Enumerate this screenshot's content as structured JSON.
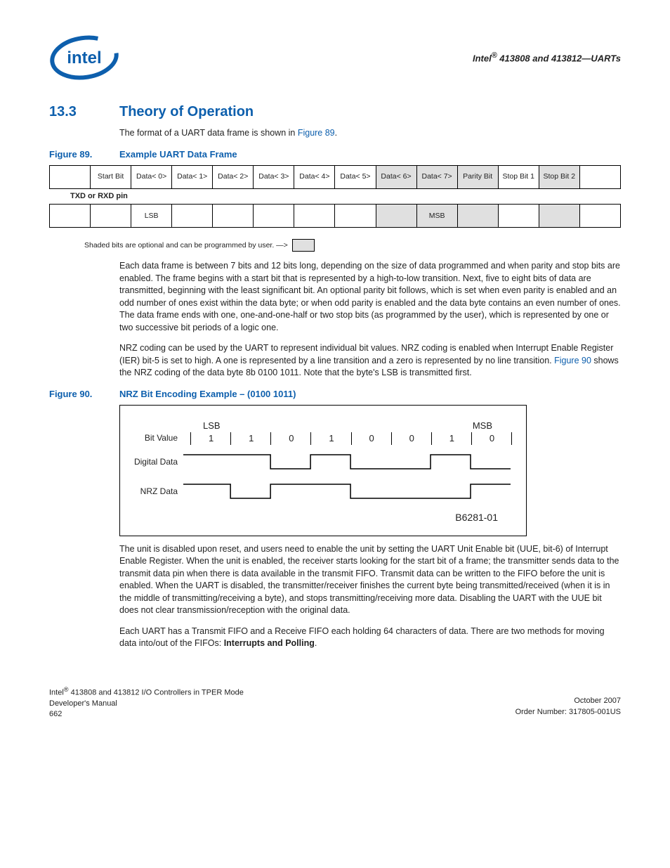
{
  "header": {
    "text_prefix": "Intel",
    "text_suffix": " 413808 and 413812—UARTs"
  },
  "section": {
    "num": "13.3",
    "title": "Theory of Operation"
  },
  "intro": {
    "pre": "The format of a UART data frame is shown in ",
    "link": "Figure 89",
    "post": "."
  },
  "fig89": {
    "num": "Figure 89.",
    "title": "Example UART Data Frame",
    "cols": [
      "",
      "Start Bit",
      "Data< 0>",
      "Data< 1>",
      "Data< 2>",
      "Data< 3>",
      "Data< 4>",
      "Data< 5>",
      "Data< 6>",
      "Data< 7>",
      "Parity Bit",
      "Stop Bit 1",
      "Stop Bit 2",
      ""
    ],
    "pin": "TXD or RXD pin",
    "row2": [
      "",
      "",
      "LSB",
      "",
      "",
      "",
      "",
      "",
      "",
      "MSB",
      "",
      "",
      "",
      ""
    ],
    "shade_note": "Shaded bits are optional and can be programmed by user. —>"
  },
  "para1": "Each data frame is between 7 bits and 12 bits long, depending on the size of data programmed and when parity and stop bits are enabled. The frame begins with a start bit that is represented by a high-to-low transition. Next, five to eight bits of data are transmitted, beginning with the least significant bit. An optional parity bit follows, which is set when even parity is enabled and an odd number of ones exist within the data byte; or when odd parity is enabled and the data byte contains an even number of ones. The data frame ends with one, one-and-one-half or two stop bits (as programmed by the user), which is represented by one or two successive bit periods of a logic one.",
  "para2": {
    "pre": "NRZ coding can be used by the UART to represent individual bit values. NRZ coding is enabled when Interrupt Enable Register (IER) bit-5 is set to high. A one is represented by a line transition and a zero is represented by no line transition. ",
    "link": "Figure 90",
    "post": " shows the NRZ coding of the data byte 8b 0100 1011. Note that the byte's LSB is transmitted first."
  },
  "fig90": {
    "num": "Figure 90.",
    "title": "NRZ Bit Encoding Example – (0100 1011)",
    "lsb": "LSB",
    "msb": "MSB",
    "bitvalue_label": "Bit Value",
    "digital_label": "Digital Data",
    "nrz_label": "NRZ Data",
    "bits": [
      "1",
      "1",
      "0",
      "1",
      "0",
      "0",
      "1",
      "0"
    ],
    "code": "B6281-01"
  },
  "para3": "The unit is disabled upon reset, and users need to enable the unit by setting the UART Unit Enable bit (UUE, bit-6) of Interrupt Enable Register. When the unit is enabled, the receiver starts looking for the start bit of a frame; the transmitter sends data to the transmit data pin when there is data available in the transmit FIFO. Transmit data can be written to the FIFO before the unit is enabled. When the UART is disabled, the transmitter/receiver finishes the current byte being transmitted/received (when it is in the middle of transmitting/receiving a byte), and stops transmitting/receiving more data. Disabling the UART with the UUE bit does not clear transmission/reception with the original data.",
  "para4": {
    "pre": "Each UART has a Transmit FIFO and a Receive FIFO each holding 64 characters of data. There are two methods for moving data into/out of the FIFOs: ",
    "bold": "Interrupts and Polling",
    "post": "."
  },
  "footer": {
    "left1_pre": "Intel",
    "left1_post": " 413808 and 413812 I/O Controllers in TPER Mode",
    "left2": "Developer's Manual",
    "left3": "662",
    "right1": "October 2007",
    "right2": "Order Number: 317805-001US"
  },
  "chart_data": {
    "type": "table",
    "title": "NRZ Bit Encoding Example – (0100 1011)",
    "bit_order": "LSB first",
    "bit_values": [
      1,
      1,
      0,
      1,
      0,
      0,
      1,
      0
    ],
    "digital_levels": [
      1,
      1,
      0,
      1,
      0,
      0,
      1,
      0
    ],
    "nrz_levels_after_bit": [
      0,
      1,
      1,
      0,
      0,
      0,
      1,
      1
    ],
    "note": "NRZ: 1 = line transition, 0 = no transition. Initial line high."
  }
}
